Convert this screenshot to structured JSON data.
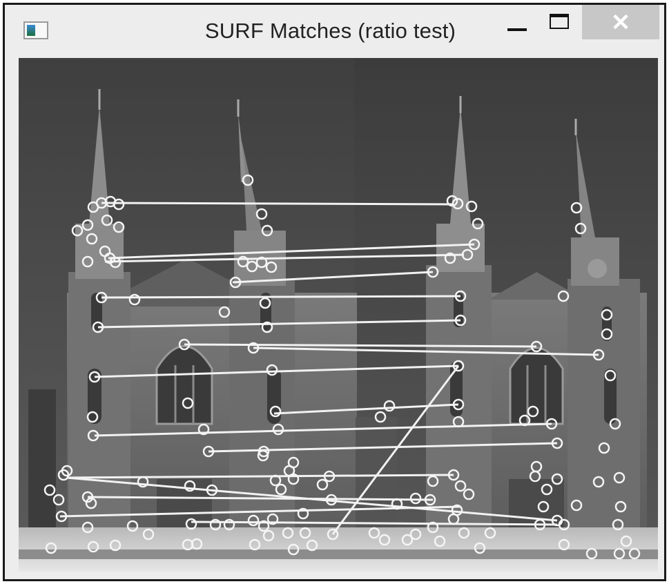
{
  "window": {
    "title": "SURF Matches (ratio test)",
    "buttons": {
      "minimize": "minimize",
      "maximize": "maximize",
      "close": "✕"
    }
  },
  "image": {
    "description_icon": "image-icon",
    "colors": {
      "sky": "#525252",
      "stone": "#6a6a6a",
      "marker": "#ffffff"
    }
  }
}
